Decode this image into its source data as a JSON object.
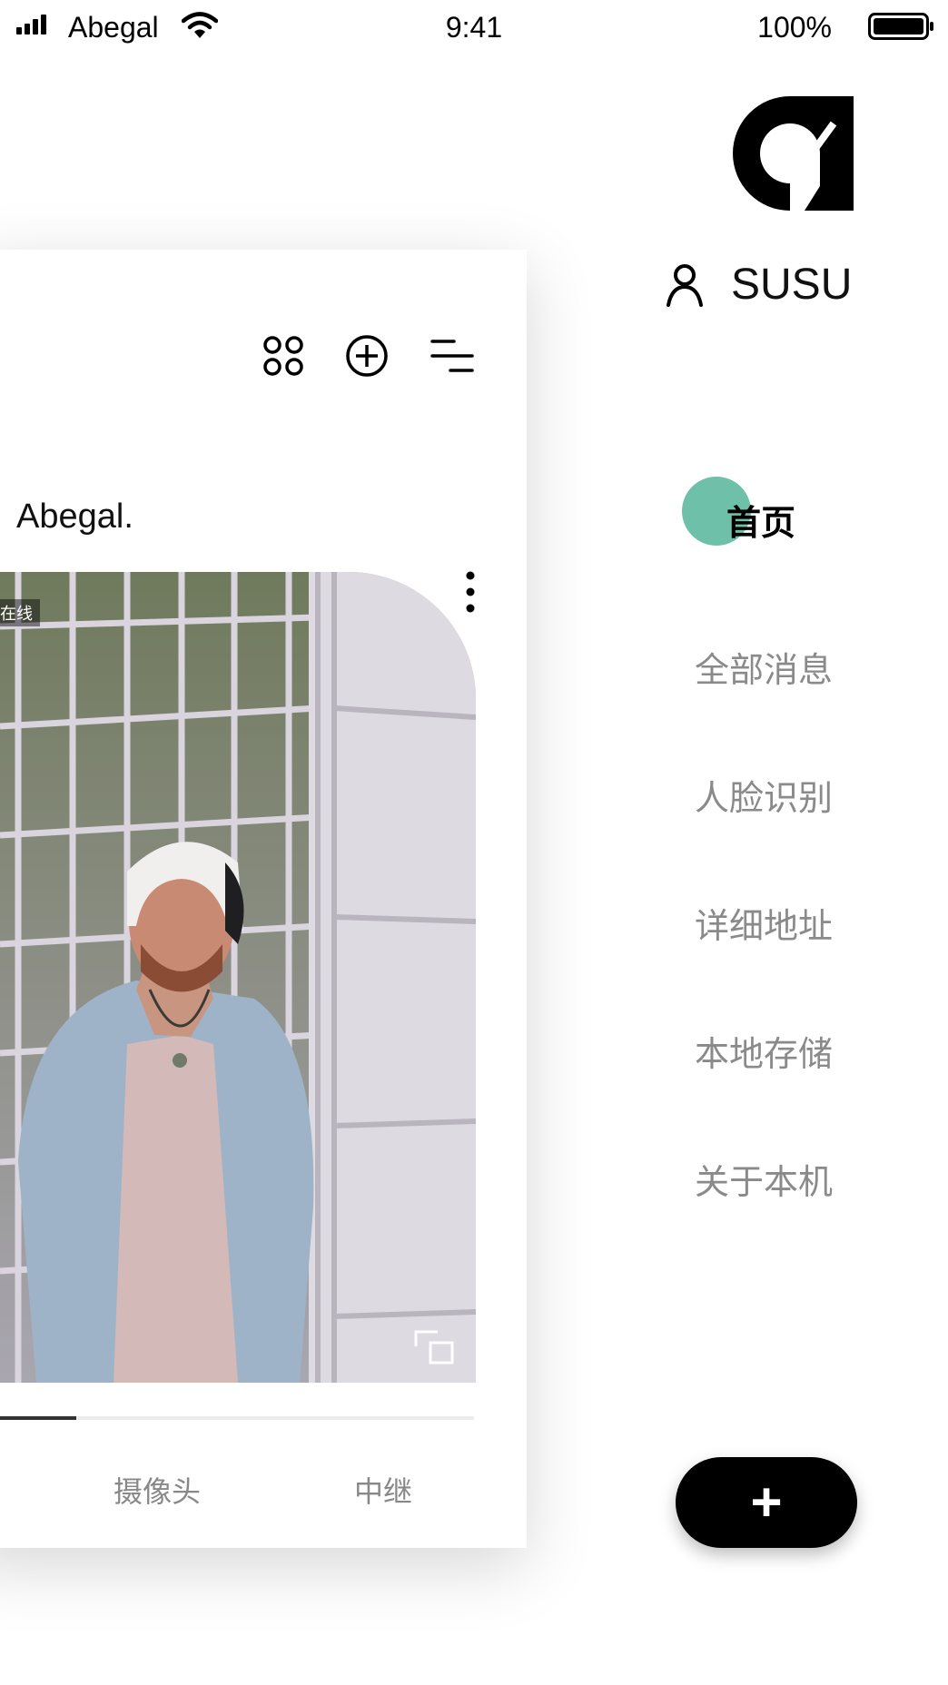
{
  "status_bar": {
    "carrier": "Abegal",
    "time": "9:41",
    "battery": "100%"
  },
  "card": {
    "toolbar_icons": [
      "grid-icon",
      "add-circle-icon",
      "filter-icon"
    ],
    "owner_name": "Abegal.",
    "camera": {
      "status_badge": "在线",
      "more_icon": "more-vertical-icon",
      "expand_icon": "expand-icon"
    },
    "progress_fraction": 0.16,
    "tabs": [
      {
        "label": "摄像头"
      },
      {
        "label": "中继"
      }
    ]
  },
  "drawer": {
    "logo_icon": "brand-logo-icon",
    "user_icon": "user-icon",
    "username": "SUSU",
    "menu": [
      {
        "label": "首页",
        "active": true
      },
      {
        "label": "全部消息",
        "active": false
      },
      {
        "label": "人脸识别",
        "active": false
      },
      {
        "label": "详细地址",
        "active": false
      },
      {
        "label": "本地存储",
        "active": false
      },
      {
        "label": "关于本机",
        "active": false
      }
    ],
    "add_button_label": "+"
  },
  "colors": {
    "accent": "#6fc0a9",
    "text_primary": "#111111",
    "text_secondary": "#8a8a8a",
    "button_bg": "#000000"
  }
}
